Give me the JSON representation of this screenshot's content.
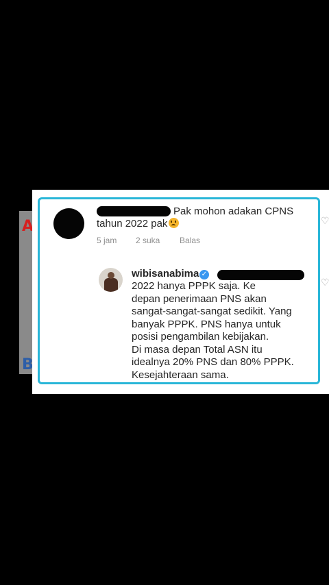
{
  "background": {
    "letter_a": "A",
    "letter_b": "B"
  },
  "comment": {
    "text_line1": "Pak mohon adakan CPNS",
    "text_line2": "tahun 2022 pak",
    "emoji": "sad-face-emoji",
    "time": "5 jam",
    "likes": "2 suka",
    "reply_label": "Balas"
  },
  "reply": {
    "username": "wibisanabima",
    "lines": [
      "2022 hanya PPPK saja. Ke",
      "depan penerimaan PNS akan",
      "sangat-sangat-sangat sedikit. Yang",
      "banyak PPPK. PNS hanya untuk",
      "posisi pengambilan kebijakan.",
      "Di masa depan Total ASN itu",
      "idealnya 20% PNS dan 80% PPPK.",
      "Kesejahteraan sama."
    ]
  },
  "colors": {
    "frame": "#29b6d8",
    "verified": "#3897f0",
    "meta": "#8e8e8e"
  }
}
